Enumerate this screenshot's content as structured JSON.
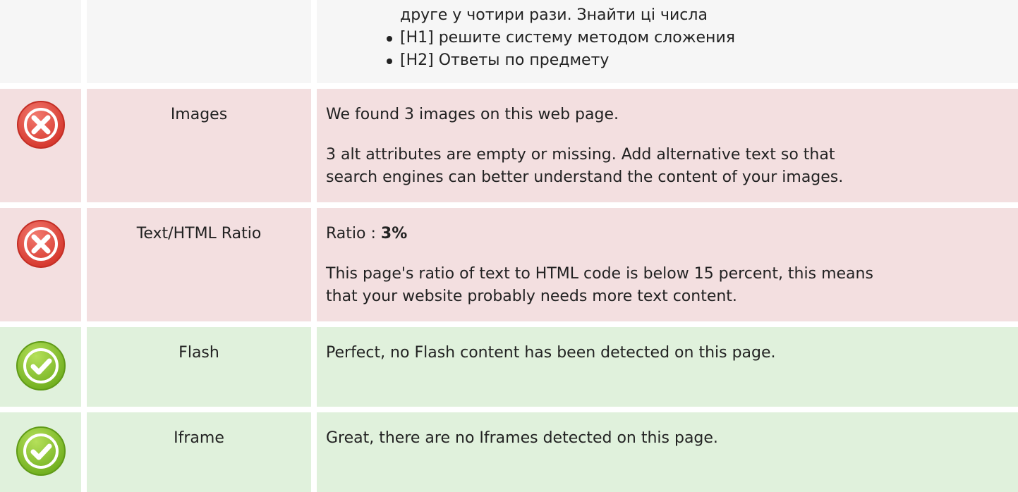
{
  "headings": {
    "continuation": "друге у чотири рази. Знайти ці числа",
    "items": [
      "[H1] решите систему методом сложения",
      "[H2] Ответы по предмету"
    ]
  },
  "checks": {
    "images": {
      "status": "fail",
      "icon": "error-x-icon",
      "label": "Images",
      "line1": "We found 3 images on this web page.",
      "line2": "3 alt attributes are empty or missing. Add alternative text so that",
      "line3": "search engines can better understand the content of your images."
    },
    "ratio": {
      "status": "fail",
      "icon": "error-x-icon",
      "label": "Text/HTML Ratio",
      "ratio_prefix": "Ratio : ",
      "ratio_value": "3%",
      "line2": "This page's ratio of text to HTML code is below 15 percent, this means",
      "line3": "that your website probably needs more text content."
    },
    "flash": {
      "status": "pass",
      "icon": "check-icon",
      "label": "Flash",
      "line1": "Perfect, no Flash content has been detected on this page."
    },
    "iframe": {
      "status": "pass",
      "icon": "check-icon",
      "label": "Iframe",
      "line1": "Great, there are no Iframes detected on this page."
    }
  },
  "colors": {
    "fail_row": "#f3dfe0",
    "pass_row": "#e0f1dc",
    "neutral_row": "#f6f6f6",
    "error_icon": "#e0453c",
    "check_icon": "#8cc63f"
  }
}
